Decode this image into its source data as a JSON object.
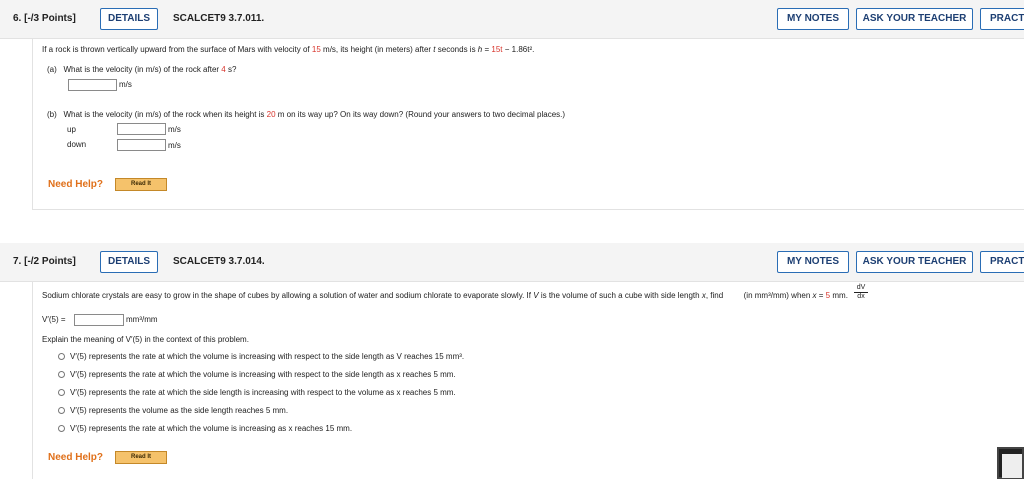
{
  "q6": {
    "num": "6. [-/3 Points]",
    "details": "DETAILS",
    "code": "SCALCET9 3.7.011.",
    "my_notes": "MY NOTES",
    "ask": "ASK YOUR TEACHER",
    "practice": "PRACTI",
    "stem_pre": "If a rock is thrown vertically upward from the surface of Mars with velocity of",
    "stem_v": "15",
    "stem_mid": "m/s, its height (in meters) after",
    "stem_t": "t",
    "stem_mid2": "seconds is",
    "stem_h": "h",
    "stem_eq": "=",
    "stem_15t": "15t",
    "stem_rest": "− 1.86t².",
    "a_label": "(a)",
    "a_q_pre": "What is the velocity (in m/s) of the rock after",
    "a_q_val": "4",
    "a_q_post": "s?",
    "a_unit": "m/s",
    "b_label": "(b)",
    "b_q_pre": "What is the velocity (in m/s) of the rock when its height is",
    "b_q_val": "20",
    "b_q_post": "m on its way up? On its way down? (Round your answers to two decimal places.)",
    "b_up": "up",
    "b_down": "down",
    "b_unit_up": "m/s",
    "b_unit_down": "m/s",
    "need_help": "Need Help?",
    "read_it": "Read It"
  },
  "q7": {
    "num": "7. [-/2 Points]",
    "details": "DETAILS",
    "code": "SCALCET9 3.7.014.",
    "my_notes": "MY NOTES",
    "ask": "ASK YOUR TEACHER",
    "practice": "PRACTI",
    "stem_pre": "Sodium chlorate crystals are easy to grow in the shape of cubes by allowing a solution of water and sodium chlorate to evaporate slowly. If",
    "stem_V": "V",
    "stem_mid": "is the volume of such a cube with side length",
    "stem_x": "x",
    "stem_find": ", find",
    "frac_num": "dV",
    "frac_den": "dx",
    "stem_units": "(in mm³/mm) when",
    "stem_x2": "x",
    "stem_eq": "=",
    "stem_val": "5",
    "stem_end": "mm.",
    "answer_label": "V′(5) =",
    "answer_unit": "mm³/mm",
    "explain": "Explain the meaning of V′(5) in the context of this problem.",
    "options": [
      "V′(5) represents the rate at which the volume is increasing with respect to the side length as V reaches 15 mm³.",
      "V′(5) represents the rate at which the volume is increasing with respect to the side length as x reaches 5 mm.",
      "V′(5) represents the rate at which the side length is increasing with respect to the volume as x reaches 5 mm.",
      "V′(5) represents the volume as the side length reaches 5 mm.",
      "V′(5) represents the rate at which the volume is increasing as x reaches 15 mm."
    ],
    "need_help": "Need Help?",
    "read_it": "Read It"
  }
}
